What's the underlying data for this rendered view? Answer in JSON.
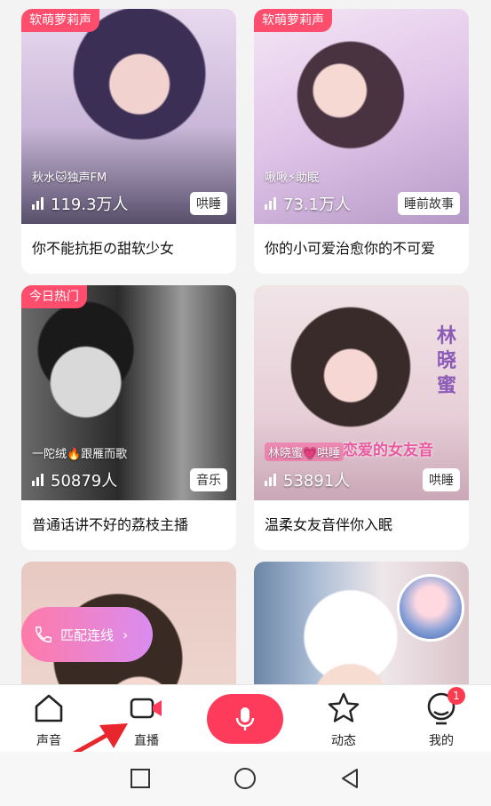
{
  "cards": [
    {
      "tag": "软萌萝莉声",
      "host": "秋水🐱独声FM",
      "count": "119.3万人",
      "category": "哄睡",
      "title": "你不能抗拒の甜软少女"
    },
    {
      "tag": "软萌萝莉声",
      "host": "啾啾⚡助眠",
      "count": "73.1万人",
      "category": "睡前故事",
      "title": "你的小可爱治愈你的不可爱"
    },
    {
      "tag": "今日热门",
      "host": "一陀绒🔥跟雁而歌",
      "count": "50879人",
      "category": "音乐",
      "title": "普通话讲不好的荔枝主播"
    },
    {
      "tag": "",
      "host": "林晓蜜💗哄睡",
      "count": "53891人",
      "category": "哄睡",
      "title": "温柔女友音伴你入眠",
      "overlay": "恋爱的女友音",
      "side": "林晓蜜"
    }
  ],
  "match_button": {
    "label": "匹配连线"
  },
  "tabbar": {
    "tabs": [
      {
        "label": "声音",
        "icon": "home-icon"
      },
      {
        "label": "直播",
        "icon": "live-camera-icon"
      },
      {
        "label": "动态",
        "icon": "star-icon"
      },
      {
        "label": "我的",
        "icon": "profile-icon",
        "badge": "1"
      }
    ],
    "mic_icon": "microphone-icon"
  },
  "colors": {
    "accent": "#ff3b5c",
    "tag": "#ff4d6d",
    "arrow": "#e8262b"
  }
}
